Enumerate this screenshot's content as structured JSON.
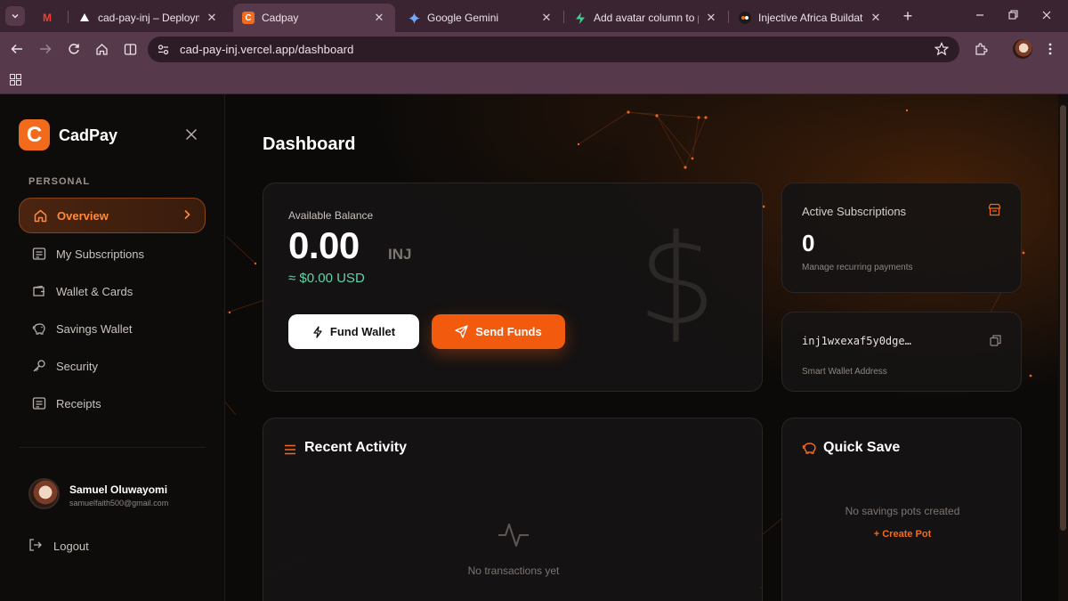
{
  "browser": {
    "tabs": [
      {
        "title": "",
        "favicon": "gmail-icon"
      },
      {
        "title": "cad-pay-inj – Deployments",
        "favicon": "vercel-icon"
      },
      {
        "title": "Cadpay",
        "favicon": "cadpay-icon"
      },
      {
        "title": "Google Gemini",
        "favicon": "gemini-icon"
      },
      {
        "title": "Add avatar column to prof",
        "favicon": "supabase-icon"
      },
      {
        "title": "Injective Africa Buildathon",
        "favicon": "injective-icon"
      }
    ],
    "url": "cad-pay-inj.vercel.app/dashboard",
    "colors": {
      "tabbar": "#3a2431",
      "toolbar": "#56394a",
      "omnibox": "#2d1c26"
    }
  },
  "sidebar": {
    "brand_letter": "C",
    "brand_name": "CadPay",
    "section_label": "PERSONAL",
    "items": [
      {
        "label": "Overview",
        "icon": "home-icon",
        "active": true
      },
      {
        "label": "My Subscriptions",
        "icon": "receipt-list-icon"
      },
      {
        "label": "Wallet & Cards",
        "icon": "wallet-icon"
      },
      {
        "label": "Savings Wallet",
        "icon": "piggy-bank-icon"
      },
      {
        "label": "Security",
        "icon": "key-icon"
      },
      {
        "label": "Receipts",
        "icon": "receipt-icon"
      }
    ],
    "user": {
      "name": "Samuel Oluwayomi",
      "email": "samuelfaith500@gmail.com"
    },
    "logout_label": "Logout"
  },
  "main": {
    "title": "Dashboard",
    "balance": {
      "label": "Available Balance",
      "value": "0.00",
      "unit": "INJ",
      "usd": "≈ $0.00 USD",
      "fund_label": "Fund Wallet",
      "send_label": "Send Funds"
    },
    "subscriptions": {
      "label": "Active Subscriptions",
      "count": "0",
      "sub": "Manage recurring payments"
    },
    "wallet": {
      "address": "inj1wxexaf5y0dge…",
      "label": "Smart Wallet Address"
    },
    "activity": {
      "title": "Recent Activity",
      "empty": "No transactions yet"
    },
    "quick_save": {
      "title": "Quick Save",
      "empty": "No savings pots created",
      "action": "+ Create Pot"
    }
  },
  "colors": {
    "accent": "#f26b1d",
    "usd_green": "#5fd3a8",
    "background": "#0b0a09"
  }
}
